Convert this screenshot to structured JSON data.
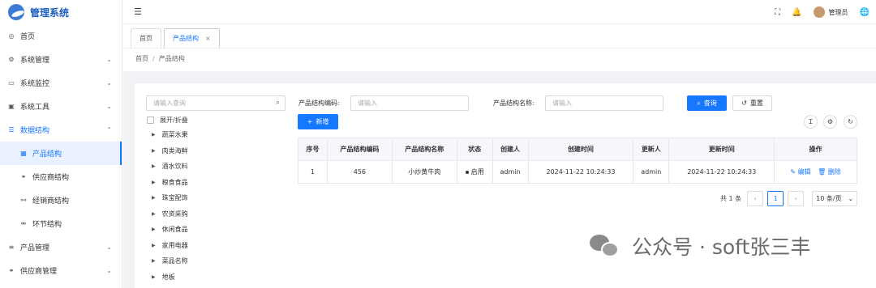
{
  "app": {
    "title": "管理系统"
  },
  "sidebar": {
    "items": [
      {
        "label": "首页",
        "icon": "dashboard-icon",
        "glyph": "◎"
      },
      {
        "label": "系统管理",
        "icon": "gear-icon",
        "glyph": "⚙",
        "chevron": "⌄"
      },
      {
        "label": "系统监控",
        "icon": "monitor-icon",
        "glyph": "▭",
        "chevron": "⌄"
      },
      {
        "label": "系统工具",
        "icon": "toolbox-icon",
        "glyph": "▣",
        "chevron": "⌄"
      },
      {
        "label": "数据结构",
        "icon": "sliders-icon",
        "glyph": "☰",
        "chevron": "⌃"
      },
      {
        "label": "产品结构",
        "icon": "grid-icon",
        "glyph": "▦"
      },
      {
        "label": "供应商结构",
        "icon": "link-icon",
        "glyph": "⚭"
      },
      {
        "label": "经销商结构",
        "icon": "share-icon",
        "glyph": "⚯"
      },
      {
        "label": "环节结构",
        "icon": "connector-icon",
        "glyph": "⚮"
      },
      {
        "label": "产品管理",
        "icon": "list-icon",
        "glyph": "≡",
        "chevron": "⌄"
      },
      {
        "label": "供应商管理",
        "icon": "link-icon",
        "glyph": "⚭",
        "chevron": "⌄"
      }
    ]
  },
  "header": {
    "menu_glyph": "☰",
    "fullscreen_glyph": "⛶",
    "bell_glyph": "🔔",
    "user_name": "管理员",
    "lang_glyph": "🌐"
  },
  "tabs": [
    {
      "label": "首页"
    },
    {
      "label": "产品结构",
      "close": "×"
    }
  ],
  "breadcrumb": {
    "root": "首页",
    "sep": "/",
    "current": "产品结构"
  },
  "tree": {
    "search_placeholder": "请输入查询",
    "search_glyph": "⌕",
    "toggle_label": "展开/折叠",
    "arrow": "▶",
    "nodes": [
      "蔬菜水果",
      "肉类海鲜",
      "酒水饮料",
      "粮食食品",
      "珠宝配饰",
      "农资采购",
      "休闲食品",
      "家用电器",
      "菜品名称",
      "地板"
    ]
  },
  "filters": {
    "code_label": "产品结构编码:",
    "code_placeholder": "请输入",
    "name_label": "产品结构名称:",
    "name_placeholder": "请输入",
    "search_btn": "查询",
    "search_glyph": "⌕",
    "reset_btn": "重置",
    "reset_glyph": "↺",
    "add_btn": "新增",
    "add_glyph": "+"
  },
  "toolbar": {
    "density_glyph": "Ɪ",
    "settings_glyph": "⚙",
    "refresh_glyph": "↻"
  },
  "table": {
    "columns": [
      "序号",
      "产品结构编码",
      "产品结构名称",
      "状态",
      "创建人",
      "创建时间",
      "更新人",
      "更新时间",
      "操作"
    ],
    "rows": [
      {
        "index": "1",
        "code": "456",
        "name": "小炒黄牛肉",
        "status": "启用",
        "creator": "admin",
        "created": "2024-11-22 10:24:33",
        "updater": "admin",
        "updated": "2024-11-22 10:24:33",
        "edit": "编辑",
        "edit_glyph": "✎",
        "delete": "删除",
        "delete_glyph": "🗑"
      }
    ]
  },
  "pagination": {
    "total": "共 1 条",
    "prev": "‹",
    "page": "1",
    "next": "›",
    "size": "10 条/页",
    "size_glyph": "⌄"
  },
  "watermark": {
    "text": "公众号 · soft张三丰"
  }
}
